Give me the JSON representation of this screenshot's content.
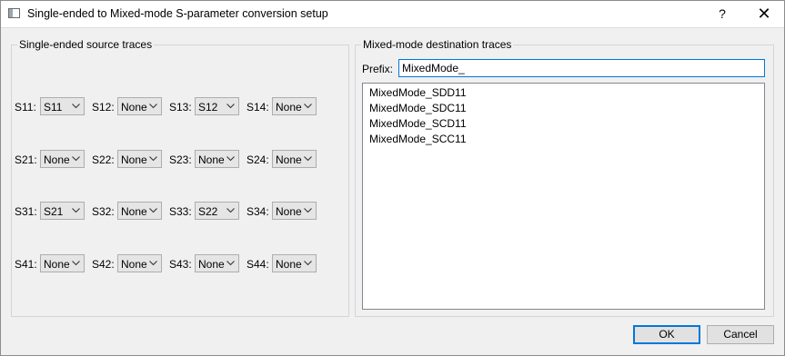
{
  "window": {
    "title": "Single-ended to Mixed-mode S-parameter conversion setup",
    "help_label": "?",
    "close_label": "✕"
  },
  "source_group": {
    "title": "Single-ended source traces",
    "rows": [
      [
        {
          "label": "S11:",
          "value": "S11"
        },
        {
          "label": "S12:",
          "value": "None"
        },
        {
          "label": "S13:",
          "value": "S12"
        },
        {
          "label": "S14:",
          "value": "None"
        }
      ],
      [
        {
          "label": "S21:",
          "value": "None"
        },
        {
          "label": "S22:",
          "value": "None"
        },
        {
          "label": "S23:",
          "value": "None"
        },
        {
          "label": "S24:",
          "value": "None"
        }
      ],
      [
        {
          "label": "S31:",
          "value": "S21"
        },
        {
          "label": "S32:",
          "value": "None"
        },
        {
          "label": "S33:",
          "value": "S22"
        },
        {
          "label": "S34:",
          "value": "None"
        }
      ],
      [
        {
          "label": "S41:",
          "value": "None"
        },
        {
          "label": "S42:",
          "value": "None"
        },
        {
          "label": "S43:",
          "value": "None"
        },
        {
          "label": "S44:",
          "value": "None"
        }
      ]
    ]
  },
  "destination_group": {
    "title": "Mixed-mode destination traces",
    "prefix_label": "Prefix:",
    "prefix_value": "MixedMode_",
    "traces": [
      "MixedMode_SDD11",
      "MixedMode_SDC11",
      "MixedMode_SCD11",
      "MixedMode_SCC11"
    ]
  },
  "buttons": {
    "ok_label": "OK",
    "cancel_label": "Cancel"
  },
  "colors": {
    "accent": "#0078d7",
    "dialog_bg": "#f0f0f0"
  }
}
